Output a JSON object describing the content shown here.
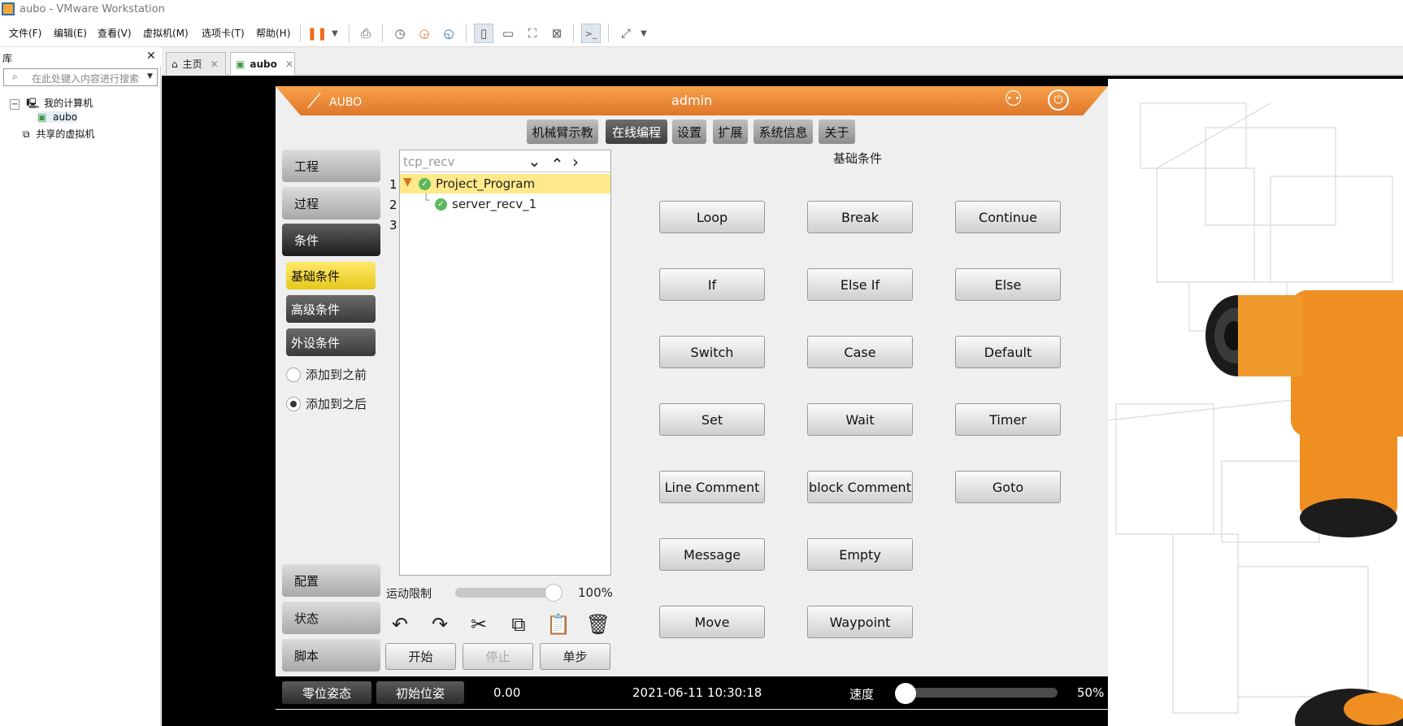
{
  "window": {
    "title": "aubo - VMware Workstation"
  },
  "menu": [
    "文件(F)",
    "编辑(E)",
    "查看(V)",
    "虚拟机(M)",
    "选项卡(T)",
    "帮助(H)"
  ],
  "library": {
    "title": "库",
    "search_placeholder": "在此处键入内容进行搜索",
    "tree": [
      "我的计算机",
      "aubo",
      "共享的虚拟机"
    ]
  },
  "tabs": [
    "主页",
    "aubo"
  ],
  "aubo": {
    "logo": "AUBO",
    "user": "admin",
    "top_tabs": [
      "机械臂示教",
      "在线编程",
      "设置",
      "扩展",
      "系统信息",
      "关于"
    ],
    "side": [
      "工程",
      "过程",
      "条件",
      "配置",
      "状态",
      "脚本"
    ],
    "sub": [
      "基础条件",
      "高级条件",
      "外设条件"
    ],
    "radios": [
      "添加到之前",
      "添加到之后"
    ],
    "tree_title": "tcp_recv",
    "tree_items": [
      "Project_Program",
      "server_recv_1"
    ],
    "line_numbers": [
      "1",
      "2",
      "3"
    ],
    "panel_title": "基础条件",
    "commands": [
      "Loop",
      "Break",
      "Continue",
      "If",
      "Else If",
      "Else",
      "Switch",
      "Case",
      "Default",
      "Set",
      "Wait",
      "Timer",
      "Line Comment",
      "block Comment",
      "Goto",
      "Message",
      "Empty",
      "Move",
      "Waypoint"
    ],
    "motion_label": "运动限制",
    "motion_value": "100%",
    "motion_level": 1.0,
    "controls": [
      "开始",
      "停止",
      "单步"
    ],
    "status": {
      "zero_pose": "零位姿态",
      "init_pose": "初始位姿",
      "value": "0.00",
      "datetime": "2021-06-11 10:30:18",
      "speed_label": "速度",
      "speed_value": "50%",
      "speed_level": 0.5
    }
  },
  "colors": {
    "accent": "#ef8a32",
    "selected": "#ffe98a",
    "dark": "#2c2c2c"
  }
}
